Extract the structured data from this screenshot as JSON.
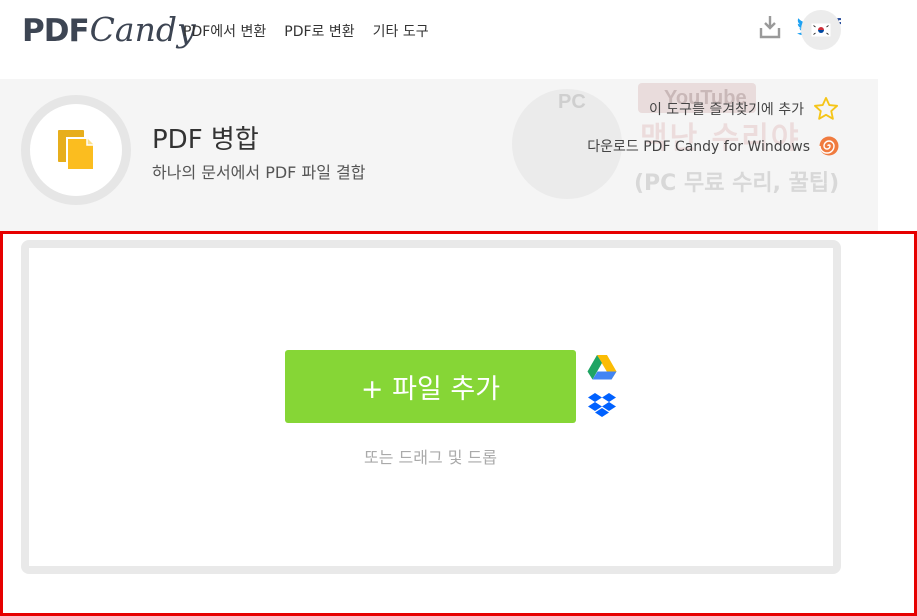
{
  "header": {
    "logo_pdf": "PDF",
    "logo_candy": "Candy",
    "nav": [
      {
        "label": "PDF에서 변환"
      },
      {
        "label": "PDF로 변환"
      },
      {
        "label": "기타 도구"
      }
    ],
    "icons": [
      "download-icon",
      "twitter-icon",
      "facebook-icon",
      "korean-flag-icon"
    ],
    "facebook_glyph": "f"
  },
  "tool": {
    "title": "PDF 병합",
    "subtitle": "하나의 문서에서 PDF 파일 결합",
    "icon": "merge-pdf-icon",
    "accent": "#fbbd1f",
    "favorite_label": "이 도구를 즐겨찾기에 추가",
    "download_label": "다운로드 PDF Candy for Windows"
  },
  "watermark": {
    "badge": "PC",
    "youtube": "YouTube",
    "title": "맥난 수리야",
    "subtitle": "(PC 무료 수리, 꿀팁)"
  },
  "upload": {
    "add_button": "+ 파일 추가",
    "drop_hint": "또는 드래그 및 드롭",
    "cloud_icons": [
      "google-drive-icon",
      "dropbox-icon"
    ],
    "button_color": "#86d636",
    "highlight_color": "#e60000"
  }
}
